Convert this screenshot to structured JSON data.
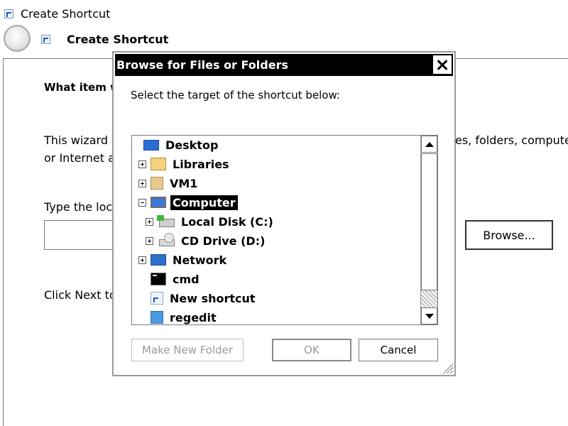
{
  "wizard": {
    "window_title": "Create Shortcut",
    "header_title": "Create Shortcut",
    "prompt_partial": "What item w",
    "description_line1_partial": "This wizard l",
    "description_line2_partial": "or Internet a",
    "description_right_partial": "es, folders, compute",
    "location_label_partial": "Type the loc",
    "location_value": "",
    "browse_label": "Browse...",
    "next_hint_partial": "Click Next to"
  },
  "dialog": {
    "title": "Browse for Files or Folders",
    "instruction": "Select the target of the shortcut below:",
    "tree": [
      {
        "label": "Desktop",
        "icon": "desktop-icon",
        "expander": "none",
        "level": 0
      },
      {
        "label": "Libraries",
        "icon": "libraries-icon",
        "expander": "plus",
        "level": 1
      },
      {
        "label": "VM1",
        "icon": "user-folder-icon",
        "expander": "plus",
        "level": 1
      },
      {
        "label": "Computer",
        "icon": "computer-icon",
        "expander": "minus",
        "level": 1,
        "selected": true
      },
      {
        "label": "Local Disk (C:)",
        "icon": "local-disk-icon",
        "expander": "plus",
        "level": 2
      },
      {
        "label": "CD Drive (D:)",
        "icon": "cd-drive-icon",
        "expander": "plus",
        "level": 2
      },
      {
        "label": "Network",
        "icon": "network-icon",
        "expander": "plus",
        "level": 1
      },
      {
        "label": "cmd",
        "icon": "cmd-icon",
        "expander": "none",
        "level": 1
      },
      {
        "label": "New shortcut",
        "icon": "shortcut-icon",
        "expander": "none",
        "level": 1
      },
      {
        "label": "regedit",
        "icon": "regedit-icon",
        "expander": "none",
        "level": 1
      }
    ],
    "buttons": {
      "new_folder": "Make New Folder",
      "ok": "OK",
      "cancel": "Cancel"
    }
  }
}
